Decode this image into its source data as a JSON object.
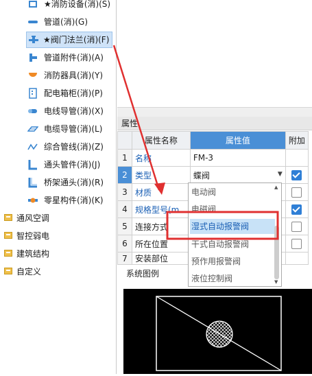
{
  "tree": {
    "items": [
      {
        "label": "★消防设备(消)(S)",
        "icon": "equipment-icon"
      },
      {
        "label": "管道(消)(G)",
        "icon": "pipe-icon"
      },
      {
        "label": "★阀门法兰(消)(F)",
        "icon": "valve-icon",
        "selected": true
      },
      {
        "label": "管道附件(消)(A)",
        "icon": "pipe-fitting-icon"
      },
      {
        "label": "消防器具(消)(Y)",
        "icon": "fire-appliance-icon"
      },
      {
        "label": "配电箱柜(消)(P)",
        "icon": "distribution-box-icon"
      },
      {
        "label": "电线导管(消)(X)",
        "icon": "wire-conduit-icon"
      },
      {
        "label": "电缆导管(消)(L)",
        "icon": "cable-conduit-icon"
      },
      {
        "label": "综合管线(消)(Z)",
        "icon": "pipeline-icon"
      },
      {
        "label": "通头管件(消)(J)",
        "icon": "tee-fitting-icon"
      },
      {
        "label": "桥架通头(消)(R)",
        "icon": "tray-tee-icon"
      },
      {
        "label": "零星构件(消)(K)",
        "icon": "misc-component-icon"
      }
    ],
    "folders": [
      {
        "label": "通风空调"
      },
      {
        "label": "智控弱电"
      },
      {
        "label": "建筑结构"
      },
      {
        "label": "自定义"
      }
    ]
  },
  "properties": {
    "header": "属性",
    "columns": [
      "属性名称",
      "属性值",
      "附加"
    ],
    "rows": [
      {
        "num": "1",
        "name": "名称",
        "value": "FM-3"
      },
      {
        "num": "2",
        "name": "类型",
        "value": "蝶阀"
      },
      {
        "num": "3",
        "name": "材质",
        "value": ""
      },
      {
        "num": "4",
        "name": "规格型号(m...",
        "value": ""
      },
      {
        "num": "5",
        "name": "连接方式",
        "value": ""
      },
      {
        "num": "6",
        "name": "所在位置",
        "value": ""
      },
      {
        "num": "7",
        "name": "安装部位",
        "value": ""
      }
    ],
    "addon_checked": [
      false,
      true,
      false,
      true,
      false,
      false,
      false
    ]
  },
  "dropdown": {
    "options": [
      "电动阀",
      "电磁阀",
      "湿式自动报警阀",
      "干式自动报警阀",
      "预作用报警阀",
      "液位控制阀"
    ],
    "highlighted": "湿式自动报警阀"
  },
  "system_diagram": {
    "label": "系统图例"
  },
  "colors": {
    "annotation": "#e03030",
    "accent": "#4a8fd6"
  }
}
